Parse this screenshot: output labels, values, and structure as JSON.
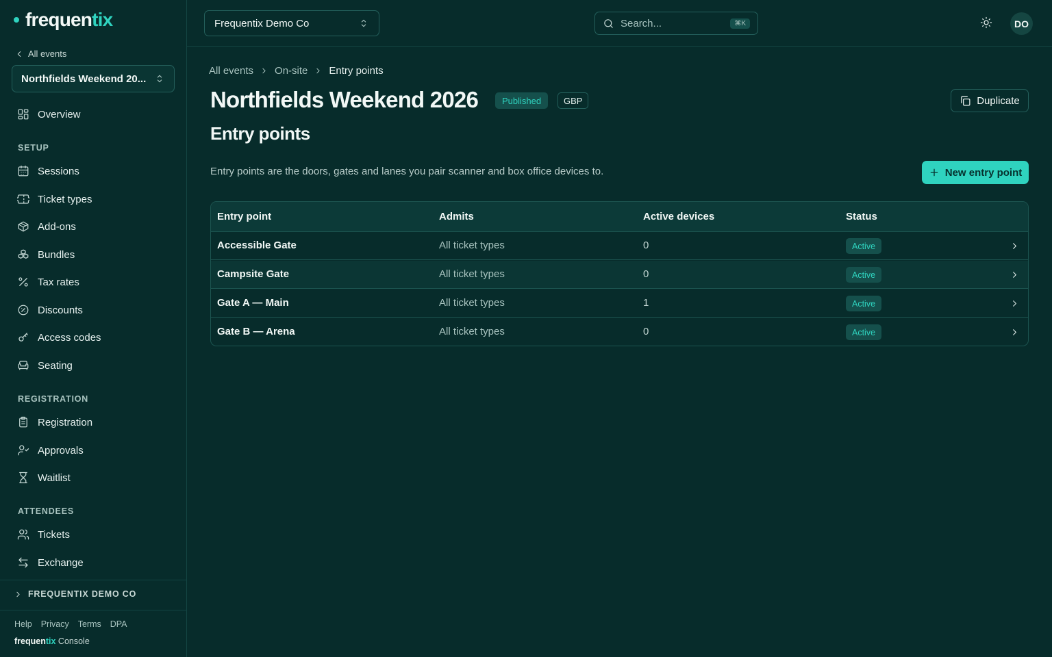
{
  "sidebar": {
    "logo_main": "frequen",
    "logo_accent": "tix",
    "back_label": "All events",
    "event_name": "Northfields Weekend 20...",
    "overview": "Overview",
    "setup_heading": "SETUP",
    "setup_items": [
      "Sessions",
      "Ticket types",
      "Add-ons",
      "Bundles",
      "Tax rates",
      "Discounts",
      "Access codes",
      "Seating"
    ],
    "registration_heading": "REGISTRATION",
    "registration_items": [
      "Registration",
      "Approvals",
      "Waitlist"
    ],
    "attendees_heading": "ATTENDEES",
    "attendees_items": [
      "Tickets",
      "Exchange"
    ],
    "org_label": "FREQUENTIX DEMO CO",
    "footer_links": [
      "Help",
      "Privacy",
      "Terms",
      "DPA"
    ],
    "footer_brand_main": "frequen",
    "footer_brand_accent": "tix",
    "footer_brand_suffix": " Console"
  },
  "topbar": {
    "org_name": "Frequentix Demo Co",
    "search_placeholder": "Search...",
    "search_shortcut": "⌘K",
    "avatar_initials": "DO"
  },
  "main": {
    "breadcrumb": [
      "All events",
      "On-site",
      "Entry points"
    ],
    "title": "Northfields Weekend 2026",
    "status_badge": "Published",
    "currency_badge": "GBP",
    "duplicate_label": "Duplicate",
    "section_title": "Entry points",
    "description": "Entry points are the doors, gates and lanes you pair scanner and box office devices to.",
    "new_button_label": "New entry point",
    "table": {
      "headers": [
        "Entry point",
        "Admits",
        "Active devices",
        "Status"
      ],
      "rows": [
        {
          "name": "Accessible Gate",
          "admits": "All ticket types",
          "devices": "0",
          "status": "Active"
        },
        {
          "name": "Campsite Gate",
          "admits": "All ticket types",
          "devices": "0",
          "status": "Active"
        },
        {
          "name": "Gate A — Main",
          "admits": "All ticket types",
          "devices": "1",
          "status": "Active"
        },
        {
          "name": "Gate B — Arena",
          "admits": "All ticket types",
          "devices": "0",
          "status": "Active"
        }
      ]
    }
  },
  "colors": {
    "background": "#072c2b",
    "accent": "#2fd3bf",
    "border": "#1c5450"
  }
}
